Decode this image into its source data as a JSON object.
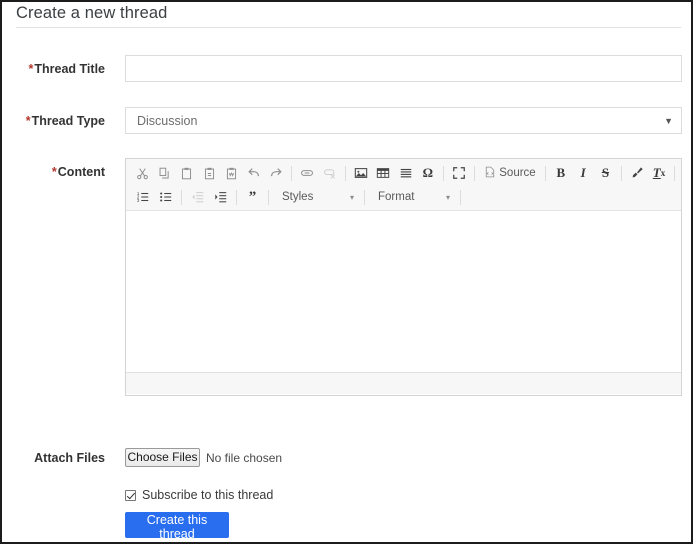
{
  "page": {
    "title": "Create a new thread"
  },
  "form": {
    "thread_title": {
      "label": "Thread Title",
      "required_marker": "*",
      "value": "",
      "placeholder": ""
    },
    "thread_type": {
      "label": "Thread Type",
      "required_marker": "*",
      "selected": "Discussion",
      "caret": "▼"
    },
    "content": {
      "label": "Content",
      "required_marker": "*",
      "value": ""
    },
    "attach_files": {
      "label": "Attach Files",
      "button_label": "Choose Files",
      "status_text": "No file chosen"
    },
    "subscribe": {
      "label": "Subscribe to this thread",
      "checked": true
    },
    "submit": {
      "label": "Create this thread"
    }
  },
  "editor_toolbar": {
    "row1": [
      {
        "name": "cut-icon",
        "title": "Cut"
      },
      {
        "name": "copy-icon",
        "title": "Copy"
      },
      {
        "name": "paste-icon",
        "title": "Paste"
      },
      {
        "name": "paste-as-plain-text-icon",
        "title": "Paste as plain text"
      },
      {
        "name": "paste-from-word-icon",
        "title": "Paste from Word"
      },
      {
        "name": "undo-icon",
        "title": "Undo"
      },
      {
        "name": "redo-icon",
        "title": "Redo"
      },
      {
        "name": "link-icon",
        "title": "Link"
      },
      {
        "name": "unlink-icon",
        "title": "Unlink"
      },
      {
        "name": "image-icon",
        "title": "Image"
      },
      {
        "name": "table-icon",
        "title": "Table"
      },
      {
        "name": "horizontal-rule-icon",
        "title": "Horizontal Line"
      },
      {
        "name": "special-character-icon",
        "title": "Insert Special Character"
      },
      {
        "name": "maximize-icon",
        "title": "Maximize"
      },
      {
        "name": "source-button",
        "title": "Source"
      },
      {
        "name": "bold-icon",
        "title": "Bold"
      },
      {
        "name": "italic-icon",
        "title": "Italic"
      },
      {
        "name": "strikethrough-icon",
        "title": "Strikethrough"
      },
      {
        "name": "copy-formatting-icon",
        "title": "Copy Formatting"
      },
      {
        "name": "remove-format-icon",
        "title": "Remove Format"
      }
    ],
    "source_label": "Source",
    "bold_glyph": "B",
    "italic_glyph": "I",
    "strike_glyph": "S",
    "remove_format_glyph": "Tx",
    "omega_glyph": "Ω",
    "styles_label": "Styles",
    "format_label": "Format",
    "caret_glyph": "▾"
  },
  "colors": {
    "accent_blue": "#2a6ef0",
    "required_red": "#b3362e",
    "toolbar_bg": "#f7f7f7",
    "border_grey": "#dcdcdc",
    "frame_border": "#1c1c1c"
  }
}
